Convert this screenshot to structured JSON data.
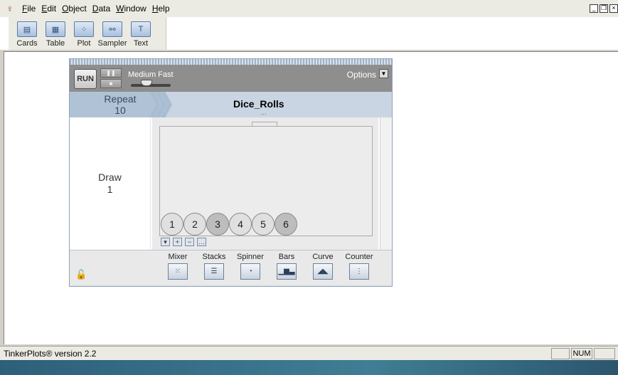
{
  "menubar": {
    "items": [
      "File",
      "Edit",
      "Object",
      "Data",
      "Window",
      "Help"
    ]
  },
  "toolbar": {
    "tools": [
      "Cards",
      "Table",
      "Plot",
      "Sampler",
      "Text"
    ]
  },
  "sampler": {
    "run_label": "RUN",
    "speed_label": "Medium Fast",
    "options_label": "Options",
    "repeat_label": "Repeat",
    "repeat_value": "10",
    "dataset_name": "Dice_Rolls",
    "draw_label": "Draw",
    "draw_value": "1",
    "balls": [
      "1",
      "2",
      "3",
      "4",
      "5",
      "6"
    ],
    "palette": [
      "Mixer",
      "Stacks",
      "Spinner",
      "Bars",
      "Curve",
      "Counter"
    ]
  },
  "status": {
    "text": "TinkerPlots® version 2.2",
    "num": "NUM"
  }
}
